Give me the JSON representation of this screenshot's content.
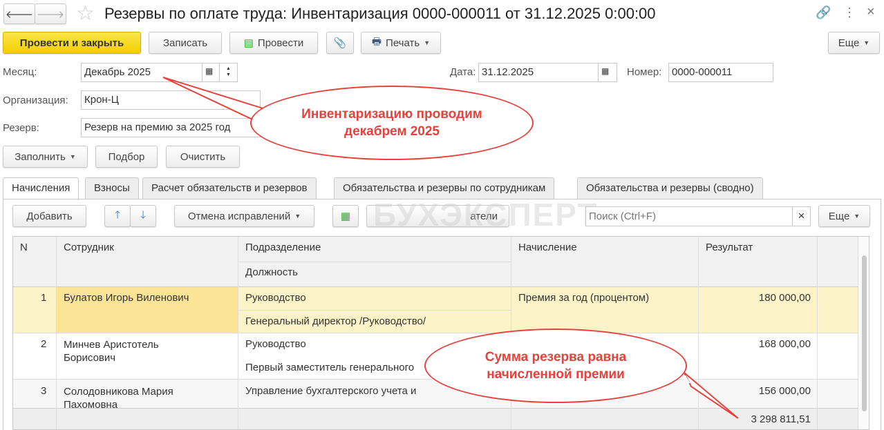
{
  "header": {
    "title": "Резервы по оплате труда: Инвентаризация 0000-000011 от 31.12.2025 0:00:00"
  },
  "toolbar": {
    "post_close": "Провести и закрыть",
    "save": "Записать",
    "post": "Провести",
    "print": "Печать",
    "more": "Еще"
  },
  "form": {
    "month_label": "Месяц:",
    "month_value": "Декабрь 2025",
    "date_label": "Дата:",
    "date_value": "31.12.2025",
    "number_label": "Номер:",
    "number_value": "0000-000011",
    "org_label": "Организация:",
    "org_value": "Крон-Ц",
    "reserve_label": "Резерв:",
    "reserve_value": "Резерв на премию за 2025 год"
  },
  "actions": {
    "fill": "Заполнить",
    "select": "Подбор",
    "clear": "Очистить"
  },
  "tabs": [
    "Начисления",
    "Взносы",
    "Расчет обязательств и резервов",
    "Обязательства и резервы по сотрудникам",
    "Обязательства и резервы (сводно)"
  ],
  "table_toolbar": {
    "add": "Добавить",
    "cancel_fix": "Отмена исправлений",
    "indicators": "атели",
    "search_placeholder": "Поиск (Ctrl+F)",
    "clear": "×",
    "more": "Еще"
  },
  "columns": {
    "n": "N",
    "employee": "Сотрудник",
    "department": "Подразделение",
    "position": "Должность",
    "accrual": "Начисление",
    "result": "Результат"
  },
  "rows": [
    {
      "n": "1",
      "employee": "Булатов Игорь Виленович",
      "department": "Руководство",
      "position": "Генеральный директор /Руководство/",
      "accrual": "Премия за год (процентом)",
      "result": "180 000,00"
    },
    {
      "n": "2",
      "employee": "Минчев Аристотель Борисович",
      "department": "Руководство",
      "position": "Первый заместитель генерального",
      "accrual": "",
      "result": "168 000,00"
    },
    {
      "n": "3",
      "employee": "Солодовникова Мария Пахомовна",
      "department": "Управление бухгалтерского учета и",
      "position": "",
      "accrual": "",
      "result": "156 000,00"
    }
  ],
  "total": "3 298 811,51",
  "callouts": {
    "month": "Инвентаризацию проводим декабрем 2025",
    "sum": "Сумма резерва равна начисленной премии"
  },
  "watermark": "БУХЭКСПЕРТ"
}
